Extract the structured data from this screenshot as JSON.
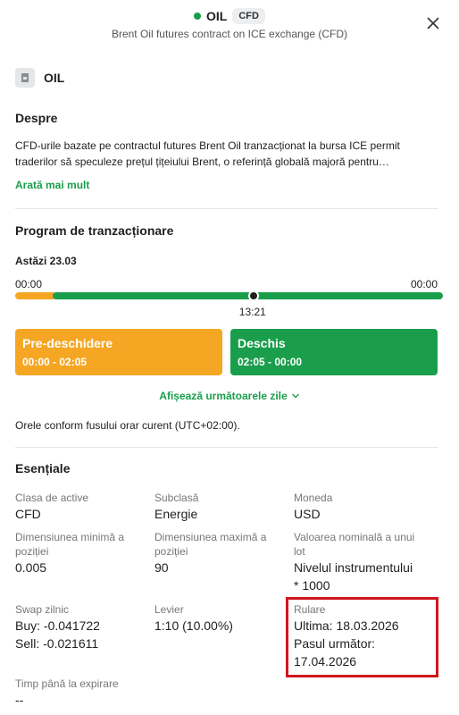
{
  "header": {
    "title": "OIL",
    "badge": "CFD",
    "subtitle": "Brent Oil futures contract on ICE exchange (CFD)",
    "status_color": "#1a9e4b"
  },
  "instrument": {
    "name": "OIL",
    "icon": "document-icon"
  },
  "about": {
    "heading": "Despre",
    "text_line1": "CFD-urile bazate pe contractul futures Brent Oil tranzacționat la bursa ICE permit",
    "text_line2": "traderilor să speculeze prețul țițeiului Brent, o referință globală majoră pentru…",
    "show_more": "Arată mai mult"
  },
  "schedule": {
    "heading": "Program de tranzacționare",
    "today": "Astăzi 23.03",
    "start": "00:00",
    "end": "00:00",
    "current_time": "13:21",
    "current_fraction": 0.557,
    "sessions": [
      {
        "name": "Pre-deschidere",
        "time": "00:00 - 02:05",
        "color": "#f5a623",
        "fraction_start": 0.0,
        "fraction_end": 0.087
      },
      {
        "name": "Deschis",
        "time": "02:05 - 00:00",
        "color": "#1a9e4b",
        "fraction_start": 0.087,
        "fraction_end": 1.0
      }
    ],
    "show_next": "Afișează următoarele zile",
    "timezone_note": "Orele conform fusului orar curent (UTC+02:00)."
  },
  "essentials": {
    "heading": "Esențiale",
    "asset_class": {
      "label": "Clasa de active",
      "value": "CFD"
    },
    "subclass": {
      "label": "Subclasă",
      "value": "Energie"
    },
    "currency": {
      "label": "Moneda",
      "value": "USD"
    },
    "min_size": {
      "label_line1": "Dimensiunea minimă a",
      "label_line2": "poziției",
      "value": "0.005"
    },
    "max_size": {
      "label_line1": "Dimensiunea maximă a",
      "label_line2": "poziției",
      "value": "90"
    },
    "nominal": {
      "label_line1": "Valoarea nominală a unui",
      "label_line2": "lot",
      "value_line1": "Nivelul instrumentului",
      "value_line2": "* 1000"
    },
    "swap": {
      "label": "Swap zilnic",
      "buy": "Buy: -0.041722",
      "sell": "Sell: -0.021611"
    },
    "leverage": {
      "label": "Levier",
      "value": "1:10 (10.00%)"
    },
    "rollover": {
      "label": "Rulare",
      "last": "Ultima: 18.03.2026",
      "next_label": "Pasul următor:",
      "next_date": "17.04.2026"
    },
    "expiry": {
      "label": "Timp până la expirare",
      "value": "--"
    }
  },
  "highlight_color": "#d0161e"
}
